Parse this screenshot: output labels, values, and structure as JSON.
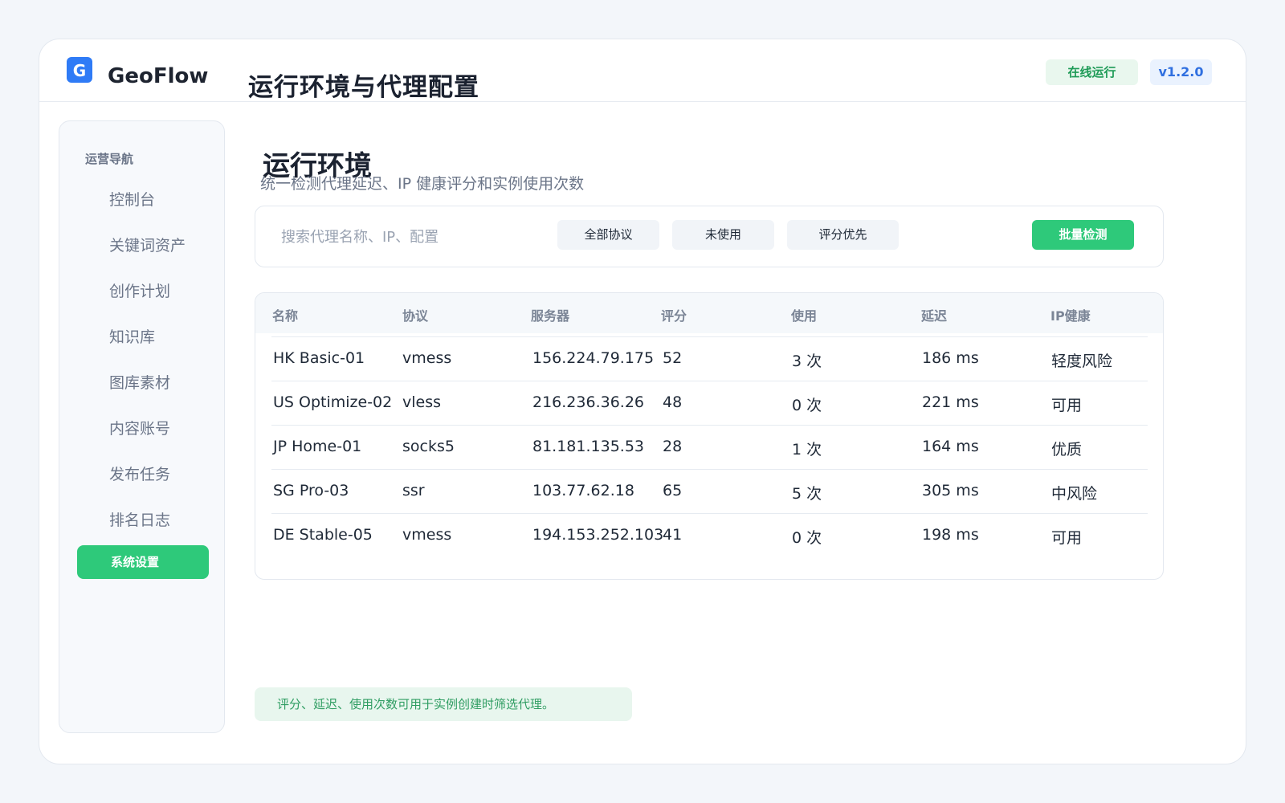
{
  "app": {
    "logo_letter": "G",
    "brand": "GeoFlow",
    "page_title": "运行环境与代理配置",
    "status": "在线运行",
    "version": "v1.2.0"
  },
  "sidebar": {
    "heading": "运营导航",
    "items": [
      {
        "label": "控制台"
      },
      {
        "label": "关键词资产"
      },
      {
        "label": "创作计划"
      },
      {
        "label": "知识库"
      },
      {
        "label": "图库素材"
      },
      {
        "label": "内容账号"
      },
      {
        "label": "发布任务"
      },
      {
        "label": "排名日志"
      },
      {
        "label": "系统设置",
        "active": true
      }
    ]
  },
  "main": {
    "section_title": "运行环境",
    "section_subtitle": "统一检测代理延迟、IP 健康评分和实例使用次数",
    "search_placeholder": "搜索代理名称、IP、配置",
    "filters": [
      "全部协议",
      "未使用",
      "评分优先"
    ],
    "batch_button": "批量检测",
    "table": {
      "headers": [
        "名称",
        "协议",
        "服务器",
        "评分",
        "使用",
        "延迟",
        "IP健康"
      ],
      "rows": [
        [
          "HK Basic-01",
          "vmess",
          "156.224.79.175",
          "52",
          "3 次",
          "186 ms",
          "轻度风险"
        ],
        [
          "US Optimize-02",
          "vless",
          "216.236.36.26",
          "48",
          "0 次",
          "221 ms",
          "可用"
        ],
        [
          "JP Home-01",
          "socks5",
          "81.181.135.53",
          "28",
          "1 次",
          "164 ms",
          "优质"
        ],
        [
          "SG Pro-03",
          "ssr",
          "103.77.62.18",
          "65",
          "5 次",
          "305 ms",
          "中风险"
        ],
        [
          "DE Stable-05",
          "vmess",
          "194.153.252.103",
          "41",
          "0 次",
          "198 ms",
          "可用"
        ]
      ]
    },
    "footer_note": "评分、延迟、使用次数可用于实例创建时筛选代理。"
  },
  "colors": {
    "accent_green": "#2ec97a",
    "accent_blue": "#2f7bf6",
    "background": "#f3f6fa"
  }
}
